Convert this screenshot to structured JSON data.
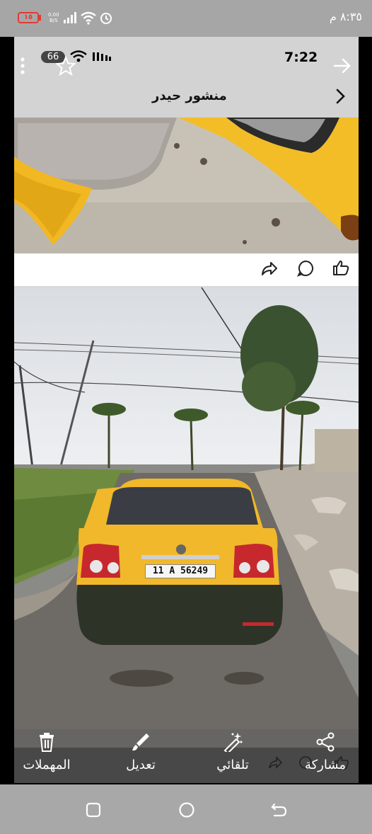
{
  "status_bar": {
    "battery": "١٥",
    "net_speed_value": "0.00",
    "net_speed_unit": "B/S",
    "time": "٨:٣٥ م"
  },
  "inner_status": {
    "badge": "66",
    "time": "7:22"
  },
  "post": {
    "title": "منشور حيدر"
  },
  "plate": {
    "text": "11 A 56249"
  },
  "bottom_actions": [
    {
      "label": "المهملات",
      "icon": "trash-icon"
    },
    {
      "label": "تعديل",
      "icon": "pencil-icon"
    },
    {
      "label": "تلقائي",
      "icon": "magic-wand-icon"
    },
    {
      "label": "مشاركة",
      "icon": "share-icon"
    }
  ],
  "colors": {
    "taxi_yellow": "#f0b82a",
    "status_bg": "#a6a6a6",
    "bar_bg": "#646464"
  }
}
